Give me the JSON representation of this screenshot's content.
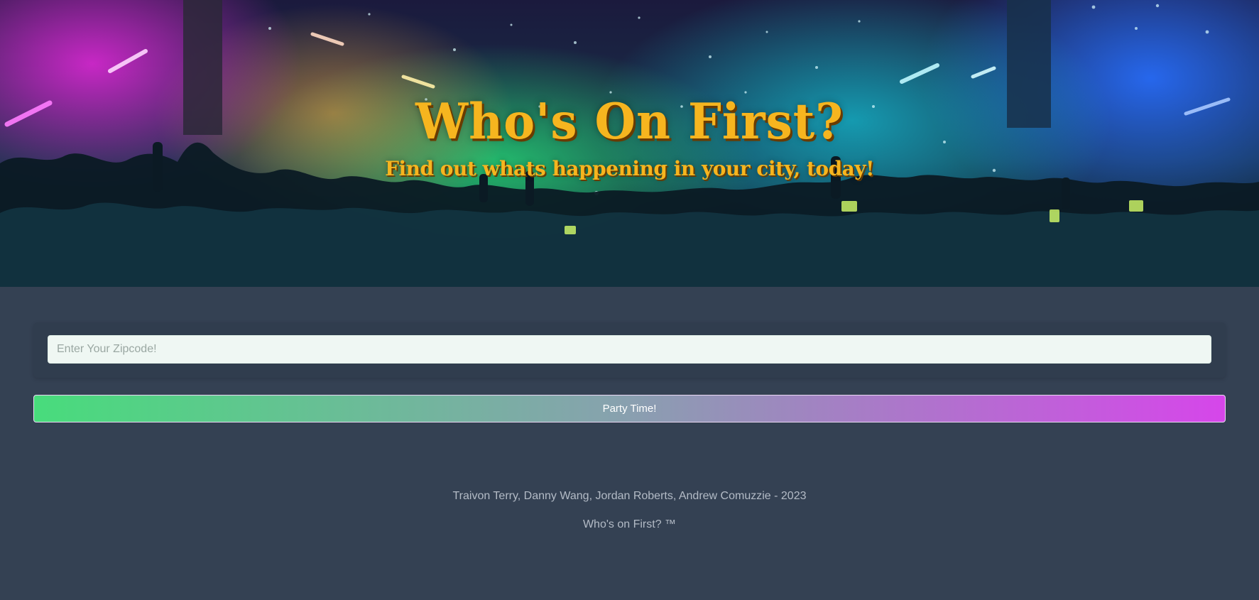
{
  "hero": {
    "title": "Who's On First?",
    "subtitle": "Find out whats happening in your city, today!"
  },
  "search": {
    "placeholder": "Enter Your Zipcode!",
    "value": ""
  },
  "actions": {
    "submit_label": "Party Time!"
  },
  "footer": {
    "credits": "Traivon Terry, Danny Wang, Jordan Roberts, Andrew Comuzzie - 2023",
    "brand": "Who's on First? ™"
  },
  "colors": {
    "page_background": "#344153",
    "title_accent": "#f6b51f",
    "button_gradient_start": "#48dc7c",
    "button_gradient_end": "#d646ea",
    "input_background": "#eff7f3"
  }
}
